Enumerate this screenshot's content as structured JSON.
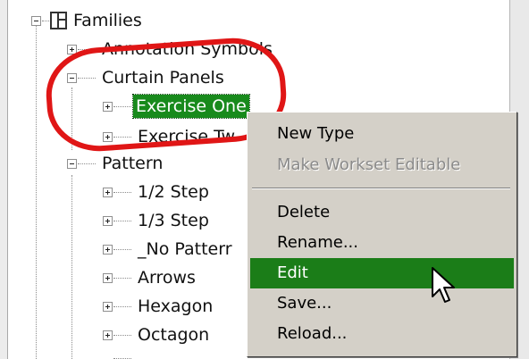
{
  "tree": {
    "root": {
      "label": "Families",
      "expander": "minus",
      "icon": "families-icon"
    },
    "nodes": [
      {
        "id": "annotation-symbols",
        "label": "Annotation Symbols",
        "expander": "plus",
        "level": 1
      },
      {
        "id": "curtain-panels",
        "label": "Curtain Panels",
        "expander": "minus",
        "level": 1
      },
      {
        "id": "exercise-one",
        "label": "Exercise One",
        "expander": "plus",
        "level": 2,
        "selected": true
      },
      {
        "id": "exercise-two",
        "label": "Exercise Tw",
        "expander": "plus",
        "level": 2
      },
      {
        "id": "pattern",
        "label": "Pattern",
        "expander": "minus",
        "level": 1
      },
      {
        "id": "half-step",
        "label": "1/2 Step",
        "expander": "plus",
        "level": 2
      },
      {
        "id": "third-step",
        "label": "1/3 Step",
        "expander": "plus",
        "level": 2
      },
      {
        "id": "no-pattern",
        "label": "_No Patterr",
        "expander": "plus",
        "level": 2
      },
      {
        "id": "arrows",
        "label": "Arrows",
        "expander": "plus",
        "level": 2
      },
      {
        "id": "hexagon",
        "label": "Hexagon",
        "expander": "plus",
        "level": 2
      },
      {
        "id": "octagon",
        "label": "Octagon",
        "expander": "plus",
        "level": 2
      }
    ]
  },
  "context_menu": {
    "items": [
      {
        "label": "New Type",
        "enabled": true
      },
      {
        "label": "Make Workset Editable",
        "enabled": false
      },
      {
        "separator": true
      },
      {
        "label": "Delete",
        "enabled": true
      },
      {
        "label": "Rename...",
        "enabled": true
      },
      {
        "label": "Edit",
        "enabled": true,
        "highlighted": true
      },
      {
        "label": "Save...",
        "enabled": true
      },
      {
        "label": "Reload...",
        "enabled": true
      }
    ]
  },
  "annotation": {
    "color": "#e01616",
    "shape": "ellipse-highlight"
  },
  "colors": {
    "selection": "#188a1c",
    "menu_highlight": "#1b7d18",
    "menu_bg": "#d4d0c8",
    "disabled_text": "#8a8a8a"
  },
  "cursor": {
    "type": "arrow-pointer-icon"
  }
}
